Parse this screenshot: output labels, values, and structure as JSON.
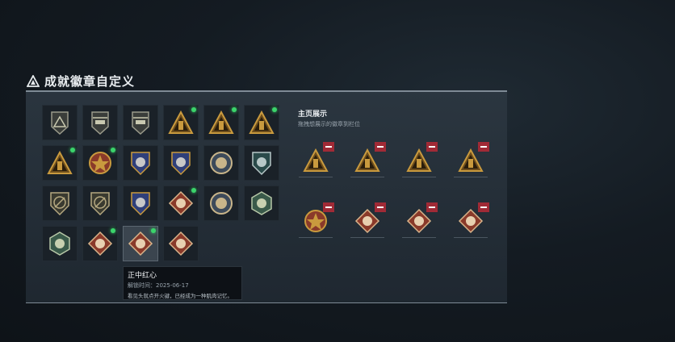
{
  "header": {
    "title": "成就徽章自定义",
    "icon": "achievement-triangle-icon"
  },
  "panel": {
    "badges": [
      {
        "icon": "triangle-rank-badge-icon",
        "new": false
      },
      {
        "icon": "helicopter-badge-icon",
        "new": false
      },
      {
        "icon": "jet-shield-badge-icon",
        "new": false
      },
      {
        "icon": "gold-triangle-pillar-badge-icon",
        "new": true
      },
      {
        "icon": "gold-triangle-tower-badge-icon",
        "new": true
      },
      {
        "icon": "gold-triangle-vehicle-badge-icon",
        "new": true
      },
      {
        "icon": "gold-triangle-artillery-badge-icon",
        "new": true
      },
      {
        "icon": "star-medal-badge-icon",
        "new": true
      },
      {
        "icon": "blue-star-shield-badge-icon",
        "new": false
      },
      {
        "icon": "eagle-shield-badge-icon",
        "new": false
      },
      {
        "icon": "skull-medallion-badge-icon",
        "new": false
      },
      {
        "icon": "green-shield-wing-badge-icon",
        "new": false
      },
      {
        "icon": "rifle-shield-badge-icon",
        "new": false
      },
      {
        "icon": "knife-shield-badge-icon",
        "new": false
      },
      {
        "icon": "navy-eagle-shield-badge-icon",
        "new": false
      },
      {
        "icon": "wolf-diamond-badge-icon",
        "new": true
      },
      {
        "icon": "eagle-circle-badge-icon",
        "new": false
      },
      {
        "icon": "green-hex-dragon-badge-icon",
        "new": false
      },
      {
        "icon": "green-hex-gun-badge-icon",
        "new": false
      },
      {
        "icon": "dragon-diamond-badge-icon",
        "new": true
      },
      {
        "icon": "dragon-diamond-selected-badge-icon",
        "new": true,
        "selected": true
      },
      {
        "icon": "soldier-diamond-badge-icon",
        "new": false
      }
    ],
    "tooltip": {
      "name": "正中红心",
      "date": "解锁时间：2025-06-17",
      "desc": "看见头就点开火键，已经成为一种肌肉记忆。"
    }
  },
  "showcase": {
    "title": "主页展示",
    "subtitle": "拖拽想展示的徽章到栏位",
    "slots": [
      {
        "icon": "gold-triangle-pillar-badge-icon"
      },
      {
        "icon": "gold-triangle-tower-badge-icon"
      },
      {
        "icon": "gold-triangle-artillery-badge-icon"
      },
      {
        "icon": "gold-triangle-vehicle-badge-icon"
      },
      {
        "icon": "star-medal-badge-icon"
      },
      {
        "icon": "dragon-diamond-badge-icon"
      },
      {
        "icon": "wolf-diamond-badge-icon"
      },
      {
        "icon": "soldier-diamond-badge-icon"
      }
    ],
    "remove_icon": "minus-icon"
  },
  "colors": {
    "accent_green": "#3bd46b",
    "remove_red": "#a02a36",
    "gold": "#c99a3e"
  }
}
